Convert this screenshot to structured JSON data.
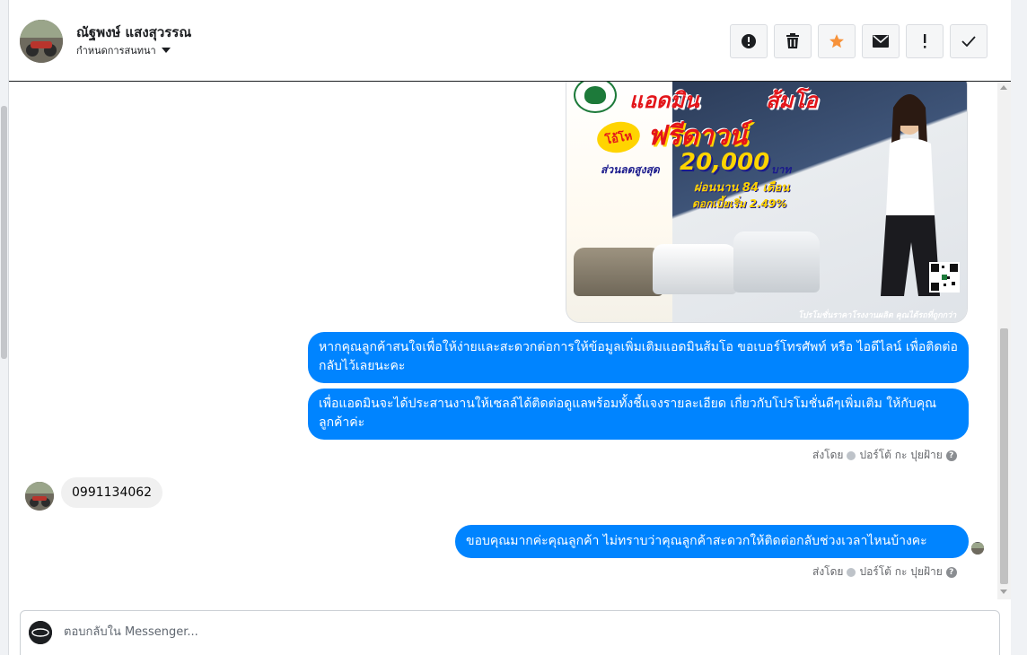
{
  "header": {
    "contact_name": "ณัฐพงษ์ แสงสุวรรณ",
    "assign_label": "กำหนดการสนทนา"
  },
  "toolbar": {
    "buttons": [
      {
        "icon": "alert-circle-icon"
      },
      {
        "icon": "trash-icon"
      },
      {
        "icon": "star-icon",
        "color": "#f7923a"
      },
      {
        "icon": "mail-icon"
      },
      {
        "icon": "exclamation-icon"
      },
      {
        "icon": "check-icon"
      }
    ]
  },
  "ad": {
    "title_left": "แอดมิน",
    "title_right": "ส้มโอ",
    "badge": "โอ้โห",
    "free_down": "ฟรีดาวน์",
    "discount_label": "ส่วนลดสูงสุด",
    "discount_value": "20,000",
    "discount_unit": "บาท",
    "installment": "ผ่อนนาน 84 เดือน",
    "interest": "ดอกเบี้ยเริ่ม 2.49%",
    "footer": "โปรโมชั่นราคาโรงงานผลิต คุณได้รถที่ถูกกว่า"
  },
  "messages": [
    {
      "direction": "out",
      "text": "หากคุณลูกค้าสนใจเพื่อให้ง่ายและสะดวกต่อการให้ข้อมูลเพิ่มเติมแอดมินส้มโอ ขอเบอร์โทรศัพท์ หรือ ไอดีไลน์ เพื่อติดต่อกลับไว้เลยนะคะ"
    },
    {
      "direction": "out",
      "text": "เพื่อแอดมินจะได้ประสานงานให้เซลล์ได้ติดต่อดูแลพร้อมทั้งชี้แจงรายละเอียด เกี่ยวกับโปรโมชั่นดีๆเพิ่มเติม ให้กับคุณลูกค้าค่ะ"
    },
    {
      "direction": "in",
      "text": "0991134062"
    },
    {
      "direction": "out",
      "text": "ขอบคุณมากค่ะคุณลูกค้า ไม่ทราบว่าคุณลูกค้าสะดวกให้ติดต่อกลับช่วงเวลาไหนบ้างคะ"
    }
  ],
  "sent_by": {
    "prefix": "ส่งโดย",
    "agent": "ปอร์โต้ กะ ปุยฝ้าย",
    "help": "?"
  },
  "composer": {
    "placeholder": "ตอบกลับใน Messenger..."
  }
}
